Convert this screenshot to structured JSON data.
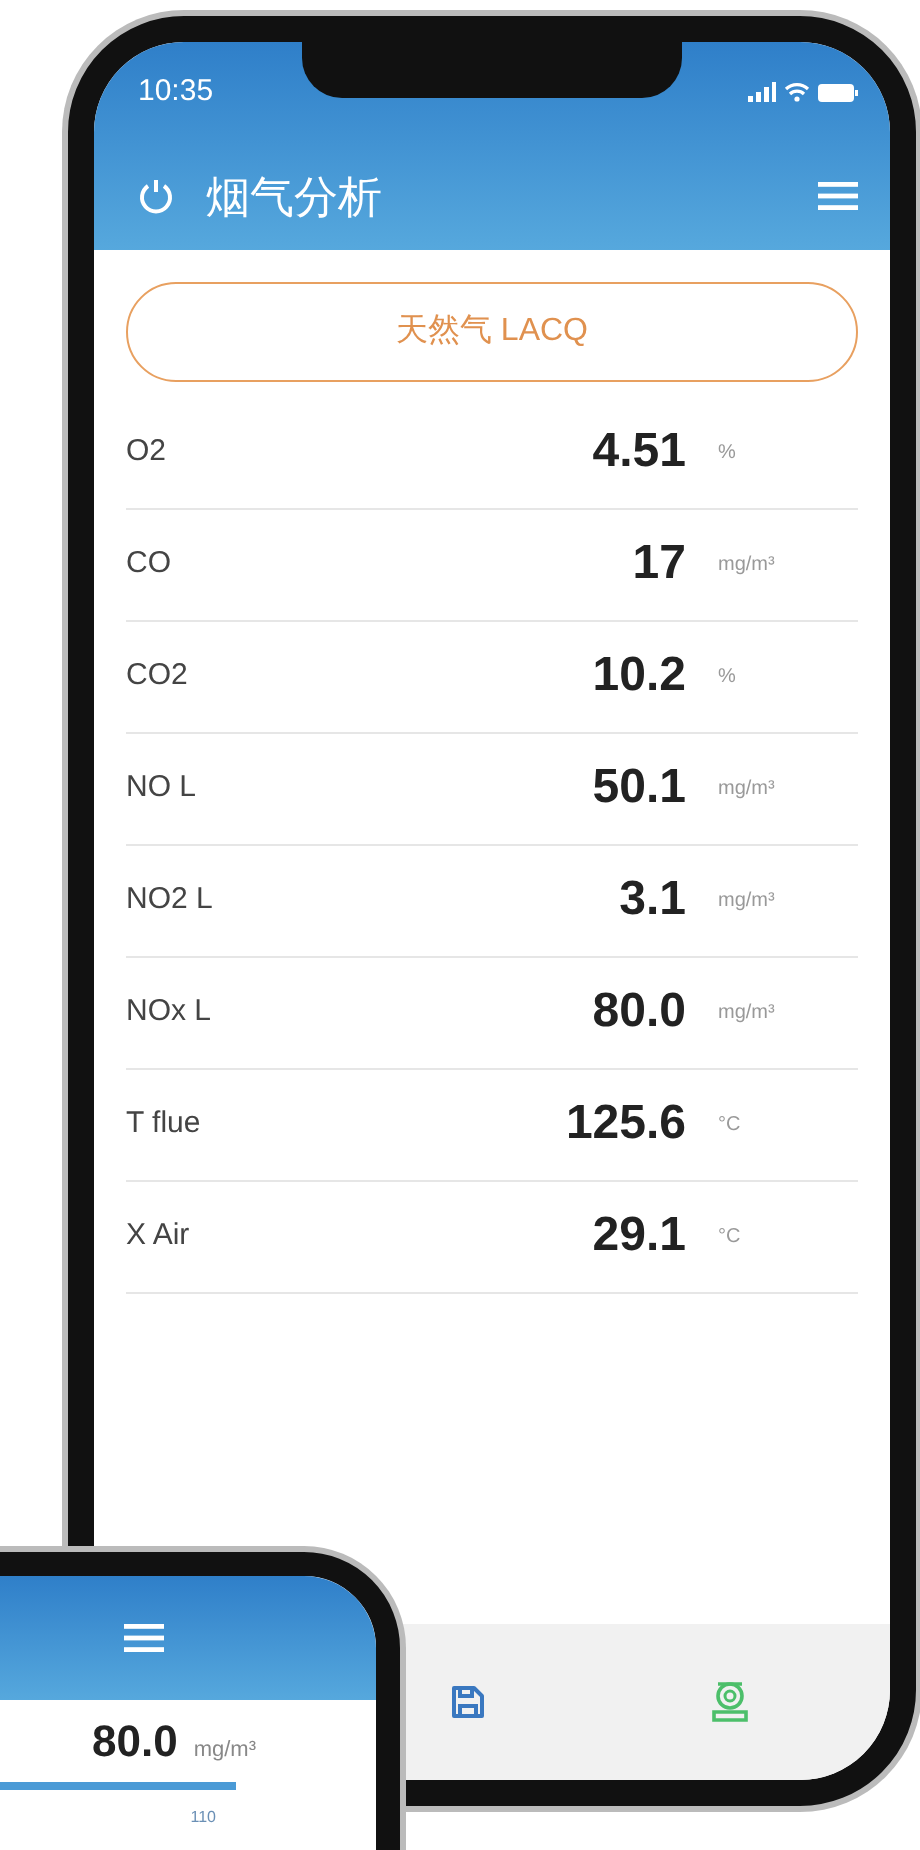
{
  "status_bar": {
    "time": "10:35"
  },
  "header": {
    "title": "烟气分析"
  },
  "fuel_button": {
    "label": "天然气 LACQ"
  },
  "readings": [
    {
      "name": "O2",
      "value": "4.51",
      "unit": "%"
    },
    {
      "name": "CO",
      "value": "17",
      "unit": "mg/m³"
    },
    {
      "name": "CO2",
      "value": "10.2",
      "unit": "%"
    },
    {
      "name": "NO L",
      "value": "50.1",
      "unit": "mg/m³"
    },
    {
      "name": "NO2 L",
      "value": "3.1",
      "unit": "mg/m³"
    },
    {
      "name": "NOx L",
      "value": "80.0",
      "unit": "mg/m³"
    },
    {
      "name": "T flue",
      "value": "125.6",
      "unit": "°C"
    },
    {
      "name": "X Air",
      "value": "29.1",
      "unit": "°C"
    }
  ],
  "second_phone": {
    "value": "80.0",
    "unit": "mg/m³",
    "scale_label": "110"
  }
}
